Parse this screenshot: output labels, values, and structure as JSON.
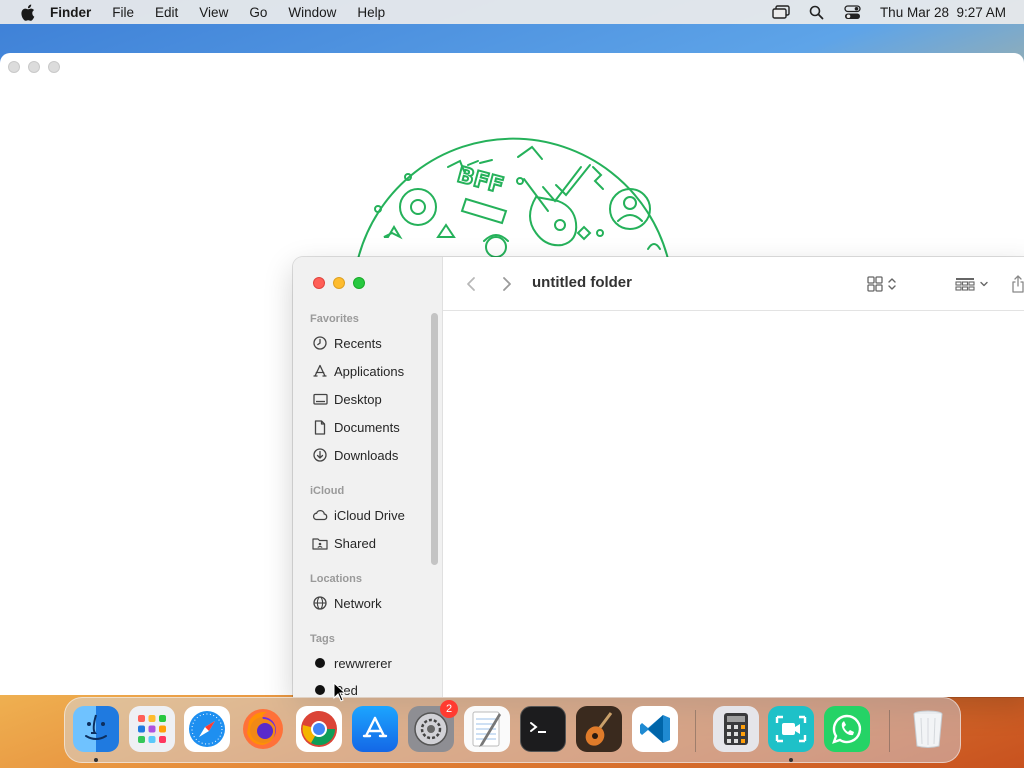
{
  "menubar": {
    "app_name": "Finder",
    "items": [
      "File",
      "Edit",
      "View",
      "Go",
      "Window",
      "Help"
    ],
    "datetime": "Thu Mar 28  9:27 AM"
  },
  "finder": {
    "title": "untitled folder",
    "sections": {
      "favorites": "Favorites",
      "icloud": "iCloud",
      "locations": "Locations",
      "tags": "Tags"
    },
    "favorites": [
      {
        "label": "Recents",
        "icon": "clock-icon"
      },
      {
        "label": "Applications",
        "icon": "applications-icon"
      },
      {
        "label": "Desktop",
        "icon": "desktop-icon"
      },
      {
        "label": "Documents",
        "icon": "document-icon"
      },
      {
        "label": "Downloads",
        "icon": "download-icon"
      }
    ],
    "icloud": [
      {
        "label": "iCloud Drive",
        "icon": "cloud-icon"
      },
      {
        "label": "Shared",
        "icon": "shared-folder-icon"
      }
    ],
    "locations": [
      {
        "label": "Network",
        "icon": "globe-icon"
      }
    ],
    "tags": [
      {
        "label": "rewwrerer",
        "color": "#111111"
      },
      {
        "label": "Red",
        "color": "#111111"
      }
    ]
  },
  "dock": {
    "apps": [
      "Finder",
      "Launchpad",
      "Safari",
      "Firefox",
      "Chrome",
      "App Store",
      "System Settings",
      "TextEdit",
      "Terminal",
      "Instruments",
      "Visual Studio Code",
      "Calculator",
      "FaceTime",
      "WhatsApp",
      "Trash"
    ],
    "settings_badge": "2"
  },
  "colors": {
    "accent_green": "#25b15a",
    "close": "#ff5f57",
    "minimize": "#febc2e",
    "maximize": "#28c840"
  }
}
